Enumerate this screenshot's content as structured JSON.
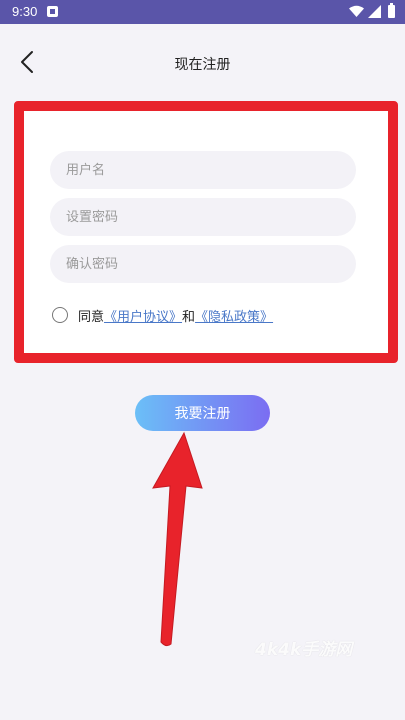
{
  "status_bar": {
    "time": "9:30"
  },
  "header": {
    "title": "现在注册",
    "back_icon": "chevron-left-icon"
  },
  "form": {
    "username_placeholder": "用户名",
    "password_placeholder": "设置密码",
    "confirm_placeholder": "确认密码",
    "agree_prefix": "同意",
    "user_agreement": "《用户协议》",
    "agree_and": "和",
    "privacy_policy": "《隐私政策》"
  },
  "register_button": "我要注册",
  "annotation": {
    "box_color": "#e8232b",
    "arrow_color": "#e8232b"
  },
  "watermark": "4k4k手游网",
  "colors": {
    "status_bar": "#5a55a9",
    "button_gradient_start": "#6bbff7",
    "button_gradient_end": "#7b6df2",
    "link": "#4a78c8"
  }
}
